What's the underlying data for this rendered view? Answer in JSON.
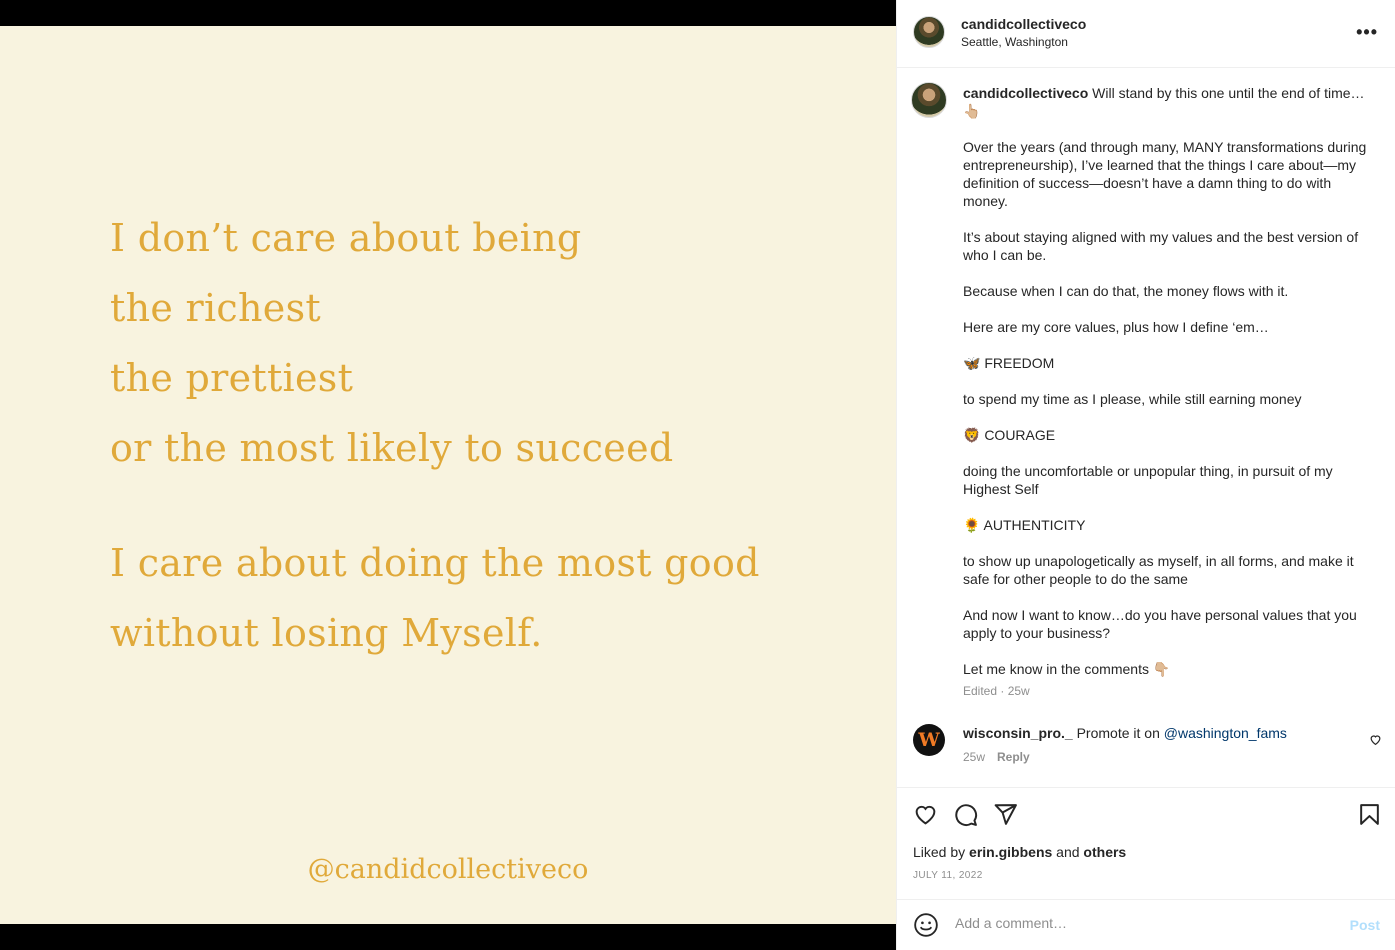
{
  "post": {
    "username": "candidcollectiveco",
    "location": "Seattle, Washington",
    "more_label": "•••"
  },
  "image_text": {
    "line1": "I don’t care about being",
    "line2": "the richest",
    "line3": "the prettiest",
    "line4": "or the most likely to succeed",
    "line5": "I care about doing the most good",
    "line6": "without losing Myself.",
    "handle": "@candidcollectiveco"
  },
  "caption": {
    "username": "candidcollectiveco",
    "p1": " Will stand by this one until the end of time… 👆🏼",
    "p2": "Over the years (and through many, MANY transformations during entrepreneurship), I’ve learned that the things I care about—my definition of success—doesn’t have a damn thing to do with money.",
    "p3": "It’s about staying aligned with my values and the best version of who I can be.",
    "p4": "Because when I can do that, the money flows with it.",
    "p5": "Here are my core values, plus how I define ‘em…",
    "p6": "🦋 FREEDOM",
    "p7": "to spend my time as I please, while still earning money",
    "p8": "🦁 COURAGE",
    "p9": "doing the uncomfortable or unpopular thing, in pursuit of my Highest Self",
    "p10": "🌻 AUTHENTICITY",
    "p11": "to show up unapologetically as myself, in all forms, and make it safe for other people to do the same",
    "p12": "And now I want to know…do you have personal values that you apply to your business?",
    "p13": "Let me know in the comments 👇🏼",
    "meta": "Edited · 25w"
  },
  "comment": {
    "username": "wisconsin_pro._",
    "text": " Promote it on ",
    "mention": "@washington_fams",
    "age": "25w",
    "reply_label": "Reply",
    "avatar_letter": "W"
  },
  "actions": {
    "liked_prefix": "Liked by ",
    "liked_user": "erin.gibbens",
    "liked_and": " and ",
    "liked_others": "others",
    "date": "JULY 11, 2022"
  },
  "add_comment": {
    "placeholder": "Add a comment…",
    "post_label": "Post"
  },
  "colors": {
    "quote_text": "#e0a93a",
    "media_bg": "#f8f3df",
    "mention": "#00376b",
    "post_disabled": "#b2dffc"
  }
}
